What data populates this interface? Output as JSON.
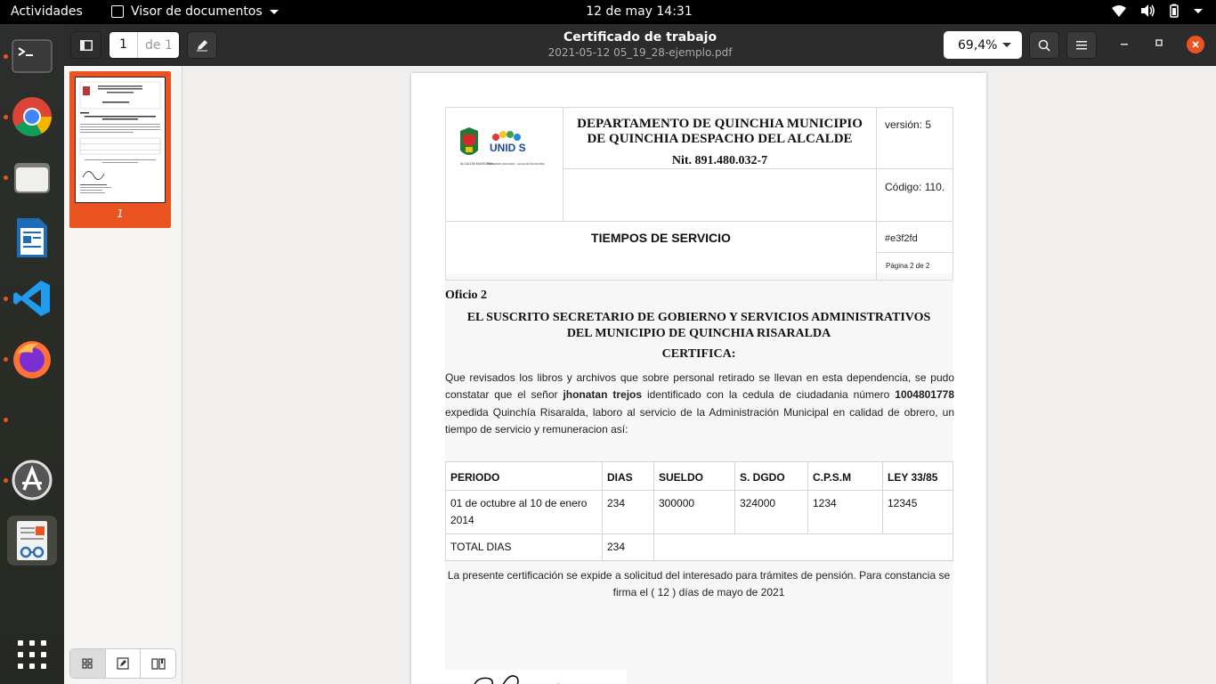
{
  "topbar": {
    "activities": "Actividades",
    "app_name": "Visor de documentos",
    "clock": "12 de may  14:31"
  },
  "dock": {
    "items": [
      "terminal-icon",
      "chrome-icon",
      "files-icon",
      "writer-icon",
      "vscode-icon",
      "firefox-icon",
      "software-icon",
      "document-viewer-icon",
      "app-grid-icon"
    ]
  },
  "headerbar": {
    "page_current": "1",
    "page_total": "de 1",
    "title": "Certificado de trabajo",
    "subtitle": "2021-05-12 05_19_28-ejemplo.pdf",
    "zoom": "69,4%"
  },
  "sidebar": {
    "thumb_page_number": "1"
  },
  "document": {
    "org_line1": "DEPARTAMENTO DE QUINCHIA MUNICIPIO",
    "org_line2": "DE QUINCHIA DESPACHO DEL ALCALDE",
    "nit": "Nit. 891.480.032-7",
    "version": "versión: 5",
    "codigo": "Código: 110.",
    "section_title": "TIEMPOS DE SERVICIO",
    "hash": "#e3f2fd",
    "pagina": "Página 2 de 2",
    "logo_text": "UNID S",
    "logo_caption1": "ALCALDÍA MUNICIPAL",
    "logo_caption2": "GOBIERNO 2020-2023 · ALCALDÍA MUNICIPAL",
    "oficio": "Oficio 2",
    "heading_line1": "EL SUSCRITO SECRETARIO DE GOBIERNO Y SERVICIOS ADMINISTRATIVOS",
    "heading_line2": "DEL MUNICIPIO DE QUINCHIA RISARALDA",
    "certifica": "CERTIFICA:",
    "para_part1": "Que revisados los libros y archivos que sobre personal retirado se llevan en esta dependencia, se pudo constatar que el señor ",
    "person_name": "jhonatan trejos",
    "para_part2": " identificado con la cedula de ciudadania número ",
    "id_number": "1004801778",
    "para_part3": " expedida Quinchía Risaralda, laboro al servicio de la Administración Municipal en calidad de obrero, un tiempo de servicio y remuneracion así:",
    "table": {
      "headers": [
        "PERIODO",
        "DIAS",
        "SUELDO",
        "S. DGDO",
        "C.P.S.M",
        "LEY 33/85"
      ],
      "rows": [
        [
          "01 de octubre al 10 de enero 2014",
          "234",
          "300000",
          "324000",
          "1234",
          "12345"
        ]
      ],
      "total_label": "TOTAL DIAS",
      "total_value": "234"
    },
    "closing_line1": "La presente certificación se expide a solicitud del interesado para trámites de pensión. Para constancia se",
    "closing_line2": "firma el ( 12 ) días de mayo de 2021"
  },
  "colors": {
    "accent": "#e95420",
    "topbar": "#000000",
    "headerbar": "#2c2c2c"
  }
}
